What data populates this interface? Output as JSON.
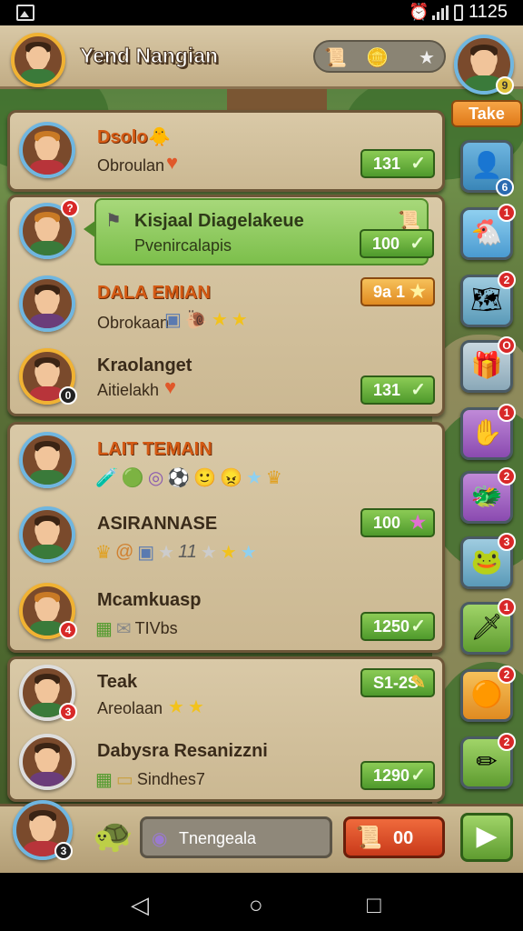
{
  "status_bar": {
    "time": "1125"
  },
  "header": {
    "player_name": "Yend Nangian",
    "take_button": "Take",
    "profile_badge": "9"
  },
  "panels": [
    {
      "rows": [
        {
          "name": "Dsolo",
          "sub": "Obroulan",
          "score": "131"
        }
      ]
    },
    {
      "rows": [
        {
          "name": "Kisjaal Diagelakeue",
          "sub": "Pvenircalapis",
          "score": "100",
          "badge": "?"
        },
        {
          "name": "DALA EMIAN",
          "sub": "Obrokaan",
          "score": "9a 1"
        },
        {
          "name": "Kraolanget",
          "sub": "Aitielakh",
          "score": "131",
          "badge": "0"
        }
      ]
    },
    {
      "rows": [
        {
          "name": "LAIT TEMAIN"
        },
        {
          "name": "ASIRANNASE",
          "score": "100",
          "count": "11"
        },
        {
          "name": "Mcamkuasp",
          "score": "1250",
          "label": "TIVbs",
          "badge": "4"
        }
      ]
    },
    {
      "rows": [
        {
          "name": "Teak",
          "sub": "Areolaan",
          "score": "S1-2S",
          "badge": "3"
        },
        {
          "name": "Dabysra Resanizzni",
          "score": "1290",
          "label": "Sindhes7"
        }
      ]
    }
  ],
  "side_buttons": [
    {
      "icon": "avatar-icon",
      "badge": "6"
    },
    {
      "icon": "chicken-icon",
      "badge": "1"
    },
    {
      "icon": "map-icon",
      "badge": "2"
    },
    {
      "icon": "chest-icon",
      "badge": "O"
    },
    {
      "icon": "hand-icon",
      "badge": "1"
    },
    {
      "icon": "dragon-icon",
      "badge": "2"
    },
    {
      "icon": "creature-icon",
      "badge": "3"
    },
    {
      "icon": "sword-icon",
      "badge": "1"
    },
    {
      "icon": "orb-icon",
      "badge": "2"
    },
    {
      "icon": "pencil-icon",
      "badge": "2"
    }
  ],
  "bottom": {
    "avatar_badge": "3",
    "chat_placeholder": "Tnengeala",
    "action_value": "00"
  },
  "colors": {
    "panel_bg": "#d9c9a7",
    "panel_border": "#6d5638",
    "score_green": "#4f9a2c",
    "accent_orange": "#e07a1a",
    "badge_red": "#d82828"
  }
}
